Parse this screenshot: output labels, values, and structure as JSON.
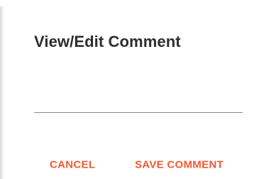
{
  "dialog": {
    "title": "View/Edit Comment",
    "comment_value": "",
    "cancel_label": "CANCEL",
    "save_label": "SAVE COMMENT"
  },
  "colors": {
    "accent": "#ef5a36",
    "title_text": "#2d2d2d",
    "underline": "#8a8a8a"
  }
}
